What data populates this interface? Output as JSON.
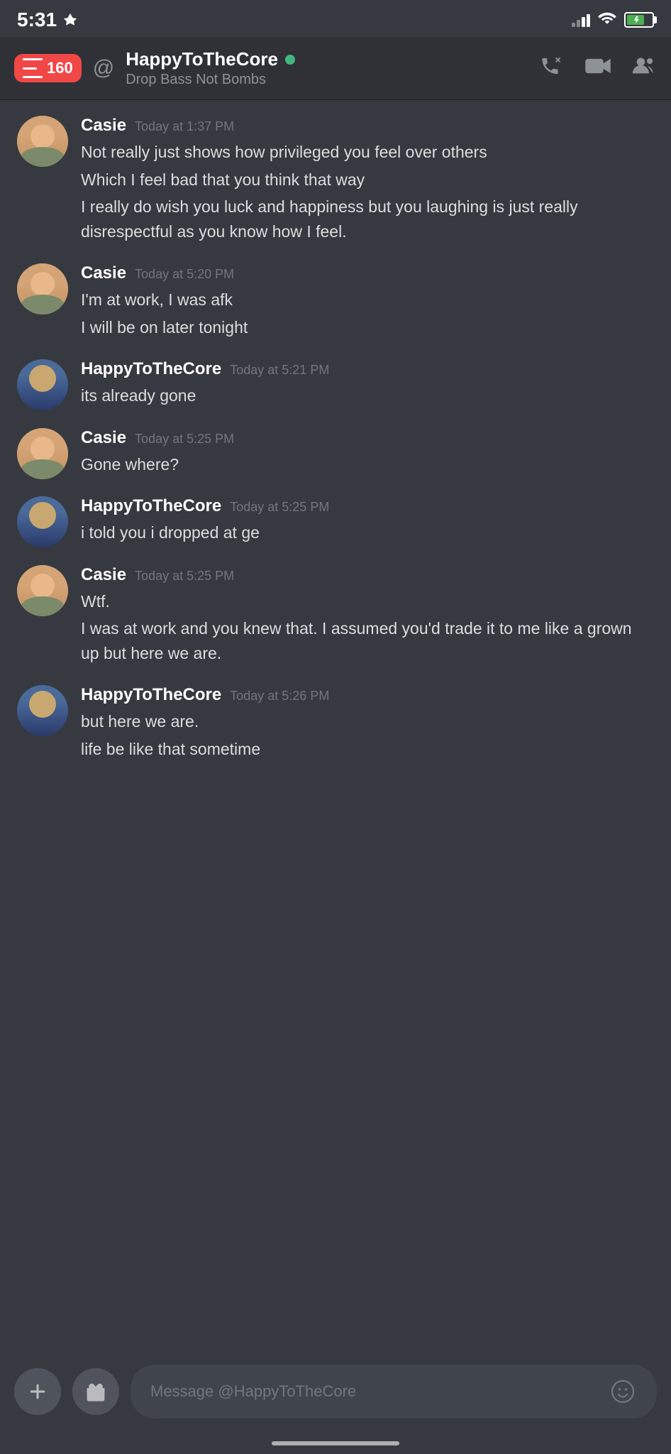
{
  "statusBar": {
    "time": "5:31",
    "hasLocation": true
  },
  "header": {
    "notificationCount": "160",
    "channelName": "HappyToTheCore",
    "subtitle": "Drop Bass Not Bombs",
    "isOnline": true
  },
  "messages": [
    {
      "id": "msg1",
      "author": "Casie",
      "authorType": "casie",
      "timestamp": "Today at 1:37 PM",
      "lines": [
        "Not really just shows how privileged you feel over others",
        "Which I feel bad that you think that way",
        "I really do wish you luck and happiness but you laughing is just really disrespectful as you know how I feel."
      ]
    },
    {
      "id": "msg2",
      "author": "Casie",
      "authorType": "casie",
      "timestamp": "Today at 5:20 PM",
      "lines": [
        "I'm at work, I was afk",
        "I will be on later tonight"
      ]
    },
    {
      "id": "msg3",
      "author": "HappyToTheCore",
      "authorType": "happy",
      "timestamp": "Today at 5:21 PM",
      "lines": [
        "its already gone"
      ]
    },
    {
      "id": "msg4",
      "author": "Casie",
      "authorType": "casie",
      "timestamp": "Today at 5:25 PM",
      "lines": [
        "Gone where?"
      ]
    },
    {
      "id": "msg5",
      "author": "HappyToTheCore",
      "authorType": "happy",
      "timestamp": "Today at 5:25 PM",
      "lines": [
        "i told you i dropped at ge"
      ]
    },
    {
      "id": "msg6",
      "author": "Casie",
      "authorType": "casie",
      "timestamp": "Today at 5:25 PM",
      "lines": [
        "Wtf.",
        "I was at work and you knew that. I assumed you'd trade it to me like a grown up but here we are."
      ]
    },
    {
      "id": "msg7",
      "author": "HappyToTheCore",
      "authorType": "happy",
      "timestamp": "Today at 5:26 PM",
      "lines": [
        "but here we are.",
        "life be like that sometime"
      ]
    }
  ],
  "inputBar": {
    "placeholder": "Message @HappyToTheCore",
    "addLabel": "+",
    "giftLabel": "🎁",
    "emojiLabel": "😊"
  }
}
